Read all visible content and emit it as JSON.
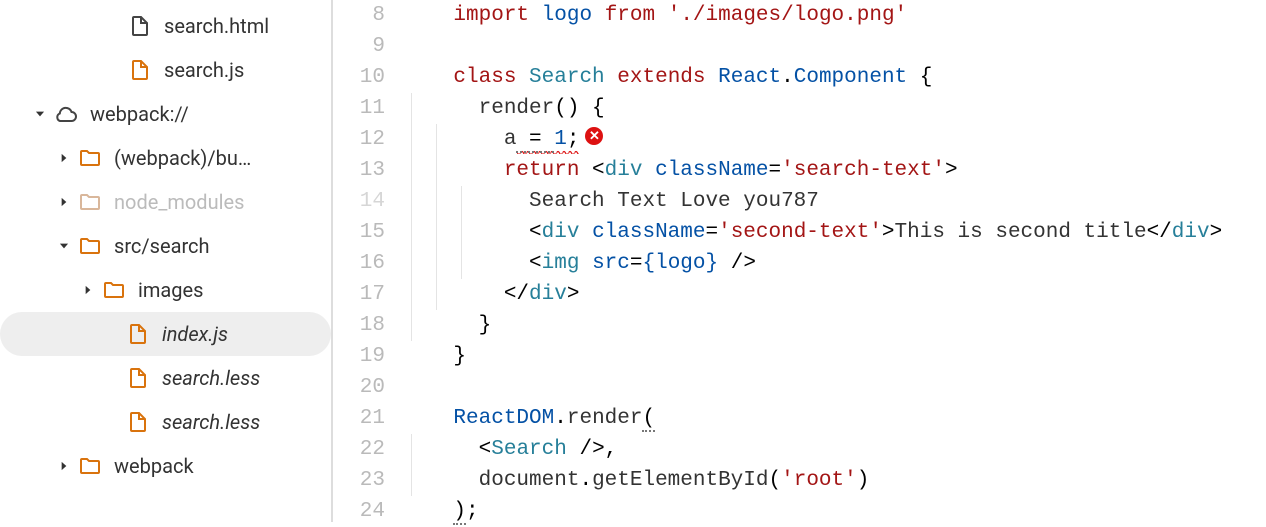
{
  "sidebar": {
    "items": [
      {
        "label": "search.html",
        "icon": "file",
        "depth": "padfile",
        "arrow": "none",
        "italic": false,
        "muted": false,
        "selected": false
      },
      {
        "label": "search.js",
        "icon": "file-orange",
        "depth": "padfile",
        "arrow": "none",
        "italic": false,
        "muted": false,
        "selected": false
      },
      {
        "label": "webpack://",
        "icon": "cloud",
        "depth": "pad0",
        "arrow": "down",
        "italic": false,
        "muted": false,
        "selected": false
      },
      {
        "label": "(webpack)/bu…",
        "icon": "folder",
        "depth": "pad1",
        "arrow": "right",
        "italic": false,
        "muted": false,
        "selected": false
      },
      {
        "label": "node_modules",
        "icon": "folder-muted",
        "depth": "pad1",
        "arrow": "right",
        "italic": false,
        "muted": true,
        "selected": false
      },
      {
        "label": "src/search",
        "icon": "folder",
        "depth": "pad1",
        "arrow": "down",
        "italic": false,
        "muted": false,
        "selected": false
      },
      {
        "label": "images",
        "icon": "folder",
        "depth": "pad2",
        "arrow": "right",
        "italic": false,
        "muted": false,
        "selected": false
      },
      {
        "label": "index.js",
        "icon": "file-orange",
        "depth": "pad3",
        "arrow": "none",
        "italic": true,
        "muted": false,
        "selected": true
      },
      {
        "label": "search.less",
        "icon": "file-orange",
        "depth": "pad3",
        "arrow": "none",
        "italic": true,
        "muted": false,
        "selected": false
      },
      {
        "label": "search.less",
        "icon": "file-orange",
        "depth": "pad3",
        "arrow": "none",
        "italic": true,
        "muted": false,
        "selected": false
      },
      {
        "label": "webpack",
        "icon": "folder",
        "depth": "pad1",
        "arrow": "right",
        "italic": false,
        "muted": false,
        "selected": false
      }
    ]
  },
  "editor": {
    "startLine": 8,
    "dimLines": [
      14
    ],
    "lines": {
      "l8": {
        "pre": "    ",
        "a": "import",
        "b": " ",
        "c": "logo",
        "d": " ",
        "e": "from",
        "f": " ",
        "g": "'./images/logo.png'"
      },
      "l9": {
        "text": ""
      },
      "l10": {
        "pre": "    ",
        "a": "class",
        "b": " ",
        "c": "Search",
        "d": " ",
        "e": "extends",
        "f": " ",
        "g": "React",
        "h": ".",
        "i": "Component",
        "j": " {"
      },
      "l11": {
        "pre": "      ",
        "a": "render",
        "b": "() {"
      },
      "l12": {
        "pre": "        ",
        "a": "a",
        "eq": " = ",
        "n": "1",
        "sc": ";"
      },
      "l13": {
        "pre": "        ",
        "a": "return",
        "b": " <",
        "c": "div",
        "d": " ",
        "e": "className",
        "f": "=",
        "g": "'search-text'",
        "h": ">"
      },
      "l14": {
        "pre": "          ",
        "a": "Search Text Love you787"
      },
      "l15": {
        "pre": "          ",
        "a": "<",
        "b": "div",
        "c": " ",
        "d": "className",
        "e": "=",
        "f": "'second-text'",
        "g": ">",
        "h": "This is second title",
        "i": "</",
        "j": "div",
        "k": ">"
      },
      "l16": {
        "pre": "          ",
        "a": "<",
        "b": "img",
        "c": " ",
        "d": "src",
        "e": "=",
        "f": "{logo}",
        "g": " />"
      },
      "l17": {
        "pre": "        ",
        "a": "</",
        "b": "div",
        "c": ">"
      },
      "l18": {
        "pre": "      ",
        "a": "}"
      },
      "l19": {
        "pre": "    ",
        "a": "}"
      },
      "l20": {
        "text": ""
      },
      "l21": {
        "pre": "    ",
        "a": "ReactDOM",
        "b": ".",
        "c": "render",
        "d": "("
      },
      "l22": {
        "pre": "      ",
        "a": "<",
        "b": "Search",
        "c": " />",
        "d": ","
      },
      "l23": {
        "pre": "      ",
        "a": "document",
        "b": ".",
        "c": "getElementById",
        "d": "(",
        "e": "'root'",
        "f": ")"
      },
      "l24": {
        "pre": "    ",
        "a": ")",
        "b": ";"
      }
    },
    "errorBadge": "✕"
  }
}
